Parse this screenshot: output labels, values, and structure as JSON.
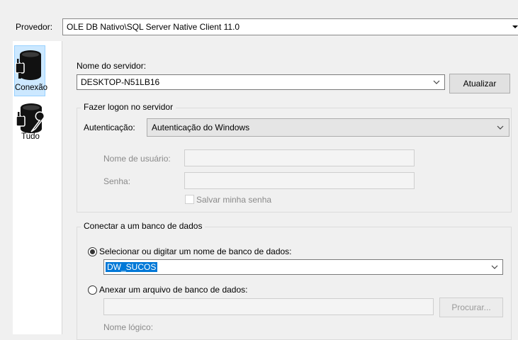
{
  "provider": {
    "label": "Provedor:",
    "value": "OLE DB Nativo\\SQL Server Native Client 11.0"
  },
  "nav": {
    "items": [
      {
        "label": "Conexão",
        "icon": "database-plug-icon",
        "selected": true
      },
      {
        "label": "Tudo",
        "icon": "database-wrench-icon",
        "selected": false
      }
    ]
  },
  "server": {
    "label": "Nome do servidor:",
    "value": "DESKTOP-N51LB16",
    "refresh_button": "Atualizar"
  },
  "logon": {
    "group_title": "Fazer logon no servidor",
    "auth_label": "Autenticação:",
    "auth_value": "Autenticação do Windows",
    "username_label": "Nome de usuário:",
    "username_value": "",
    "password_label": "Senha:",
    "password_value": "",
    "save_password_label": "Salvar minha senha"
  },
  "database": {
    "group_title": "Conectar a um banco de dados",
    "option_select_label": "Selecionar ou digitar um nome de banco de dados:",
    "db_name_value": "DW_SUCOS",
    "option_attach_label": "Anexar um arquivo de banco de dados:",
    "attach_file_value": "",
    "browse_button": "Procurar...",
    "logical_name_label": "Nome lógico:"
  },
  "colors": {
    "selection": "#0078d7",
    "nav_selected_bg": "#cce8ff",
    "window_bg": "#f0f0f0"
  }
}
